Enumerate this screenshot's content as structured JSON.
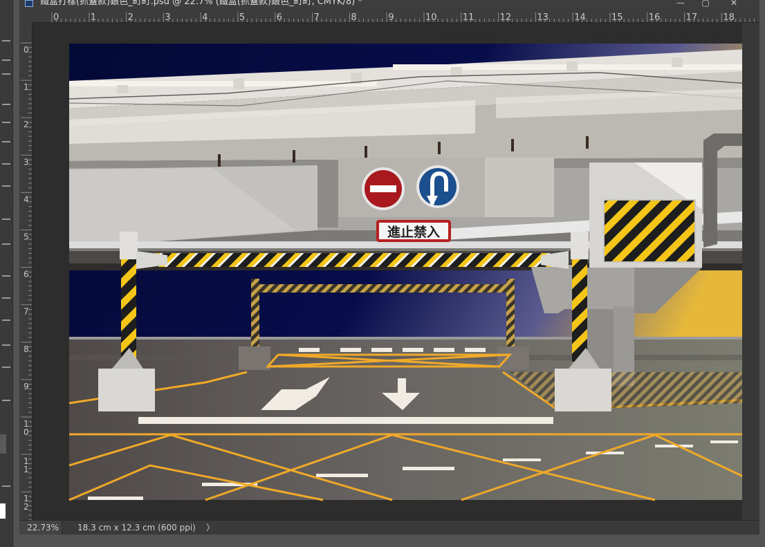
{
  "window": {
    "title": "鐵盒打樣(抓蓋款)銀色_町町.psd @ 22.7% (鐵盒(抓蓋款)銀色_町町, CMYK/8) *",
    "controls": [
      "—",
      "▢",
      "✕"
    ]
  },
  "rulers": {
    "top_labels": [
      "0",
      "1",
      "2",
      "3",
      "4",
      "5",
      "6",
      "7",
      "8",
      "9",
      "10",
      "11",
      "12",
      "13",
      "14",
      "15",
      "16",
      "17",
      "18"
    ],
    "left_labels": [
      [
        "0"
      ],
      [
        "1"
      ],
      [
        "2"
      ],
      [
        "3"
      ],
      [
        "4"
      ],
      [
        "5"
      ],
      [
        "6"
      ],
      [
        "7"
      ],
      [
        "8"
      ],
      [
        "9"
      ],
      [
        "1",
        "0"
      ],
      [
        "1",
        "1"
      ],
      [
        "1",
        "2"
      ]
    ]
  },
  "artwork": {
    "sign_text": "進止禁入"
  },
  "status": {
    "zoom": "22.73%",
    "dimensions": "18.3 cm x 12.3 cm (600 ppi)",
    "arrow": "〉"
  },
  "colors": {
    "ui_bg": "#535353",
    "panel": "#3c3c3c",
    "sky": "#060b3e",
    "stripe_yellow": "#f5c518",
    "road_line": "#f0a928"
  }
}
